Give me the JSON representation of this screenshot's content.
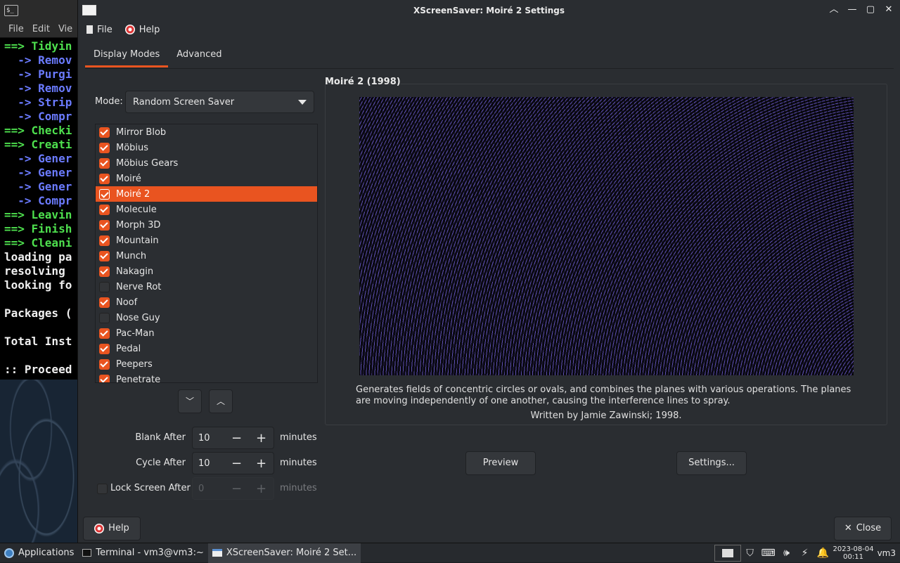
{
  "terminal": {
    "menu": [
      "File",
      "Edit",
      "Vie"
    ],
    "lines": [
      {
        "text": "==> Tidyin",
        "color": "green"
      },
      {
        "text": "  -> Remov",
        "color": "blue"
      },
      {
        "text": "  -> Purgi",
        "color": "blue"
      },
      {
        "text": "  -> Remov",
        "color": "blue"
      },
      {
        "text": "  -> Strip",
        "color": "blue"
      },
      {
        "text": "  -> Compr",
        "color": "blue"
      },
      {
        "text": "==> Checki",
        "color": "green"
      },
      {
        "text": "==> Creati",
        "color": "green"
      },
      {
        "text": "  -> Gener",
        "color": "blue"
      },
      {
        "text": "  -> Gener",
        "color": "blue"
      },
      {
        "text": "  -> Gener",
        "color": "blue"
      },
      {
        "text": "  -> Compr",
        "color": "blue"
      },
      {
        "text": "==> Leavin",
        "color": "green"
      },
      {
        "text": "==> Finish",
        "color": "green"
      },
      {
        "text": "==> Cleani",
        "color": "green"
      },
      {
        "text": "loading pa",
        "color": "white"
      },
      {
        "text": "resolving ",
        "color": "white"
      },
      {
        "text": "looking fo",
        "color": "white"
      },
      {
        "text": " ",
        "color": "white"
      },
      {
        "text": "Packages (",
        "color": "white"
      },
      {
        "text": " ",
        "color": "white"
      },
      {
        "text": "Total Inst",
        "color": "white"
      },
      {
        "text": " ",
        "color": "white"
      },
      {
        "text": ":: Proceed",
        "color": "white"
      }
    ]
  },
  "window": {
    "title": "XScreenSaver: Moiré 2 Settings",
    "controls": [
      "chevron-up",
      "minimize",
      "maximize",
      "close"
    ]
  },
  "menubar": {
    "file": "File",
    "help": "Help"
  },
  "tabs": [
    {
      "label": "Display Modes",
      "active": true
    },
    {
      "label": "Advanced",
      "active": false
    }
  ],
  "mode": {
    "label": "Mode:",
    "value": "Random Screen Saver"
  },
  "savers": [
    {
      "name": "Mirror Blob",
      "checked": true
    },
    {
      "name": "Möbius",
      "checked": true
    },
    {
      "name": "Möbius Gears",
      "checked": true
    },
    {
      "name": "Moiré",
      "checked": true
    },
    {
      "name": "Moiré 2",
      "checked": true,
      "selected": true
    },
    {
      "name": "Molecule",
      "checked": true
    },
    {
      "name": "Morph 3D",
      "checked": true
    },
    {
      "name": "Mountain",
      "checked": true
    },
    {
      "name": "Munch",
      "checked": true
    },
    {
      "name": "Nakagin",
      "checked": true
    },
    {
      "name": "Nerve Rot",
      "checked": false
    },
    {
      "name": "Noof",
      "checked": true
    },
    {
      "name": "Nose Guy",
      "checked": false
    },
    {
      "name": "Pac-Man",
      "checked": true
    },
    {
      "name": "Pedal",
      "checked": true
    },
    {
      "name": "Peepers",
      "checked": true
    },
    {
      "name": "Penetrate",
      "checked": true
    }
  ],
  "timing": {
    "blank_label": "Blank After",
    "blank_value": "10",
    "cycle_label": "Cycle After",
    "cycle_value": "10",
    "lock_label": "Lock Screen After",
    "lock_value": "0",
    "lock_checked": false,
    "unit": "minutes"
  },
  "preview": {
    "title": "Moiré 2 (1998)",
    "description": "Generates fields of concentric circles or ovals, and combines the planes with various operations. The planes are moving independently of one another, causing the interference lines to spray.",
    "credit": "Written by Jamie Zawinski; 1998.",
    "preview_button": "Preview",
    "settings_button": "Settings..."
  },
  "footer": {
    "help": "Help",
    "close": "Close"
  },
  "taskbar": {
    "applications": "Applications",
    "terminal": "Terminal - vm3@vm3:~",
    "xscreensaver": "XScreenSaver: Moiré 2 Set...",
    "date": "2023-08-04",
    "time": "00:11",
    "user": "vm3"
  }
}
